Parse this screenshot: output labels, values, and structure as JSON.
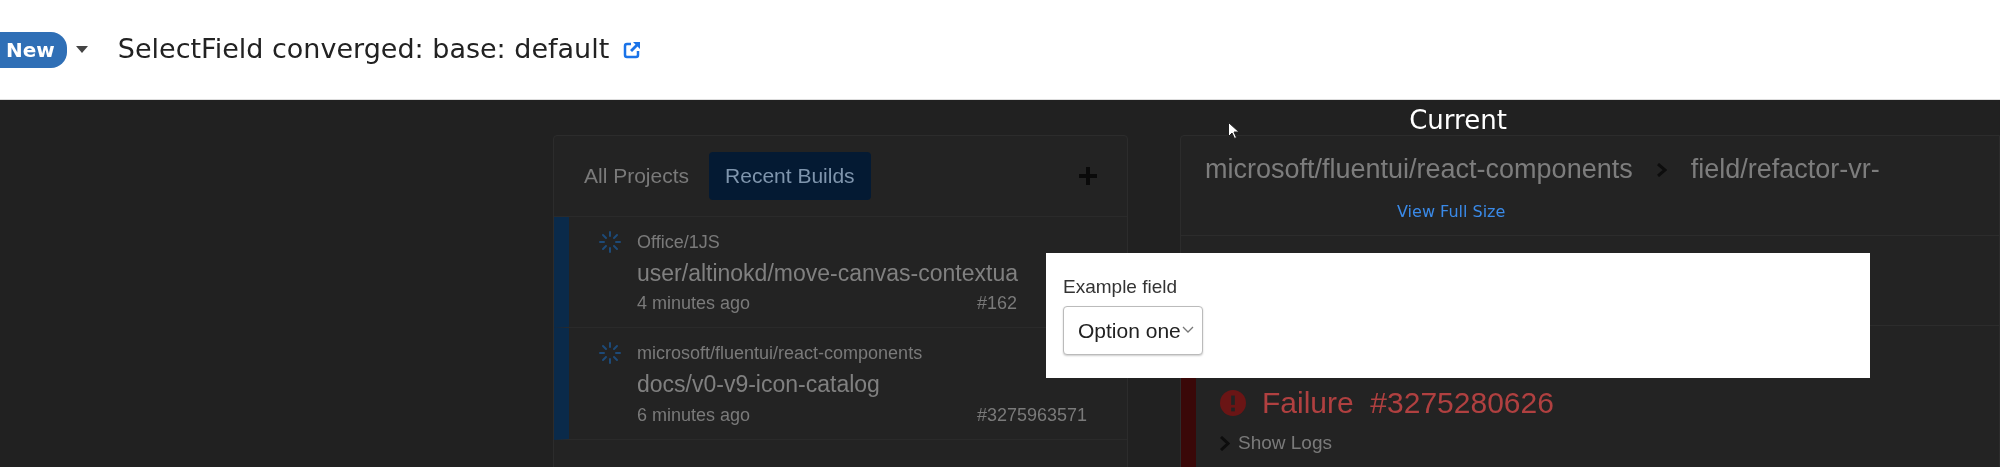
{
  "header": {
    "badge": "New",
    "title": "SelectField converged: base: default"
  },
  "background_page": {
    "tabs": [
      {
        "label": "All Projects",
        "selected": false
      },
      {
        "label": "Recent Builds",
        "selected": true
      }
    ],
    "builds": [
      {
        "project": "Office/1JS",
        "branch": "user/altinokd/move-canvas-contextua",
        "time": "4 minutes ago",
        "number": "#162"
      },
      {
        "project": "microsoft/fluentui/react-components",
        "branch": "docs/v0-v9-icon-catalog",
        "time": "6 minutes ago",
        "number": "#3275963571"
      }
    ],
    "breadcrumb": {
      "repo": "microsoft/fluentui/react-components",
      "branch": "field/refactor-vr-"
    },
    "status": "Failure  #3275280626",
    "show_logs": "Show Logs"
  },
  "viewer": {
    "title": "Current",
    "link": "View Full Size",
    "preview": {
      "label": "Example field",
      "value": "Option one"
    }
  }
}
